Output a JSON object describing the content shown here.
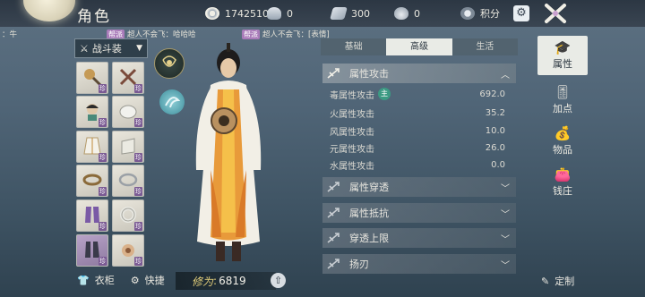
{
  "header": {
    "title": "角色",
    "resources": [
      {
        "icon": "coin-icon",
        "value": "1742510"
      },
      {
        "icon": "ingot-icon",
        "value": "0"
      },
      {
        "icon": "ticket-icon",
        "value": "300"
      },
      {
        "icon": "pouch-icon",
        "value": "0"
      },
      {
        "icon": "points-icon",
        "value": "积分"
      }
    ]
  },
  "chat": [
    {
      "prefix": "：牛"
    },
    {
      "tag": "帮派",
      "text": "超人不会飞：哈哈哈"
    },
    {
      "tag": "帮派",
      "text": "超人不会飞：[表情]"
    }
  ],
  "left": {
    "outfit_label": "战斗装",
    "slot_badge": "珍",
    "closet_label": "衣柜",
    "quick_label": "快捷",
    "cultivation_label": "修为",
    "cultivation_value": "6819"
  },
  "tabs": [
    "基础",
    "高级",
    "生活"
  ],
  "attributes": {
    "open_header": "属性攻击",
    "rows": [
      {
        "label": "毒属性攻击",
        "badge": "主",
        "value": "692.0"
      },
      {
        "label": "火属性攻击",
        "value": "35.2"
      },
      {
        "label": "风属性攻击",
        "value": "10.0"
      },
      {
        "label": "元属性攻击",
        "value": "26.0"
      },
      {
        "label": "水属性攻击",
        "value": "0.0"
      }
    ],
    "collapsed": [
      "属性穿透",
      "属性抵抗",
      "穿透上限",
      "扬刃"
    ]
  },
  "side_nav": [
    "属性",
    "加点",
    "物品",
    "钱庄"
  ],
  "custom_label": "定制",
  "colors": {
    "accent_badge": "#a97bb9",
    "active_tab": "#e9ebe6",
    "panel": "#5f6c76"
  }
}
